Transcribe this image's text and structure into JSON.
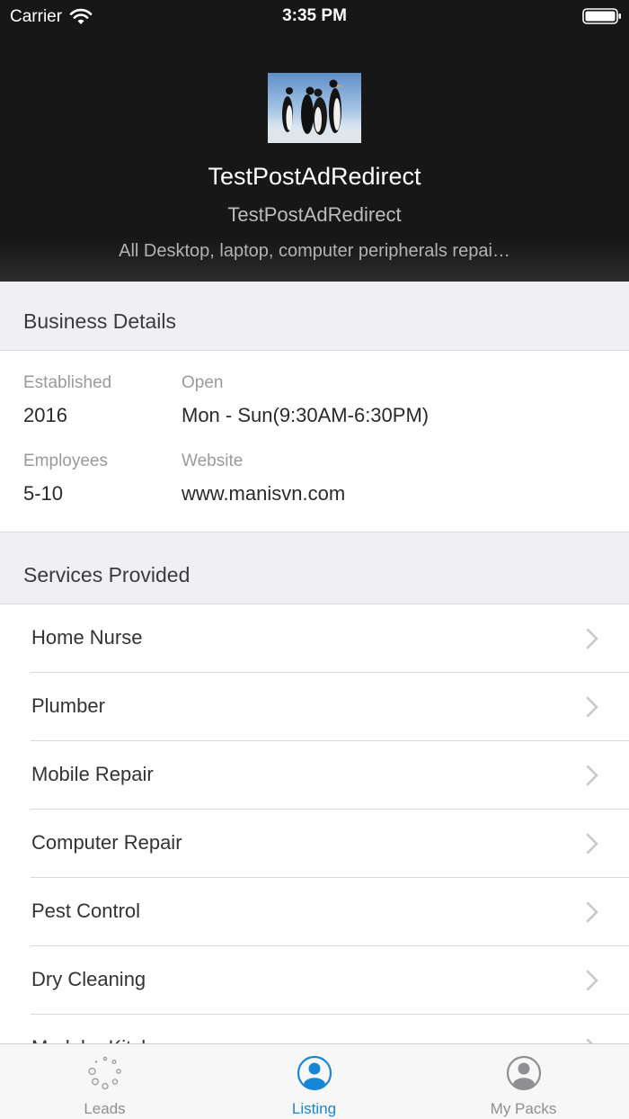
{
  "status_bar": {
    "carrier": "Carrier",
    "time": "3:35 PM"
  },
  "header": {
    "title": "TestPostAdRedirect",
    "subtitle": "TestPostAdRedirect",
    "description": "All Desktop, laptop, computer peripherals repai…"
  },
  "business_details": {
    "heading": "Business Details",
    "established_label": "Established",
    "established_value": "2016",
    "open_label": "Open",
    "open_value": "Mon - Sun(9:30AM-6:30PM)",
    "employees_label": "Employees",
    "employees_value": "5-10",
    "website_label": "Website",
    "website_value": "www.manisvn.com"
  },
  "services": {
    "heading": "Services Provided",
    "items": [
      {
        "label": "Home Nurse"
      },
      {
        "label": "Plumber"
      },
      {
        "label": "Mobile Repair"
      },
      {
        "label": "Computer Repair"
      },
      {
        "label": "Pest Control"
      },
      {
        "label": "Dry Cleaning"
      },
      {
        "label": "Modular Kitchen"
      }
    ]
  },
  "tabbar": {
    "accent": "#1687d6",
    "tabs": [
      {
        "label": "Leads",
        "icon": "spinner-icon"
      },
      {
        "label": "Listing",
        "icon": "person-icon"
      },
      {
        "label": "My Packs",
        "icon": "person-icon"
      }
    ]
  }
}
